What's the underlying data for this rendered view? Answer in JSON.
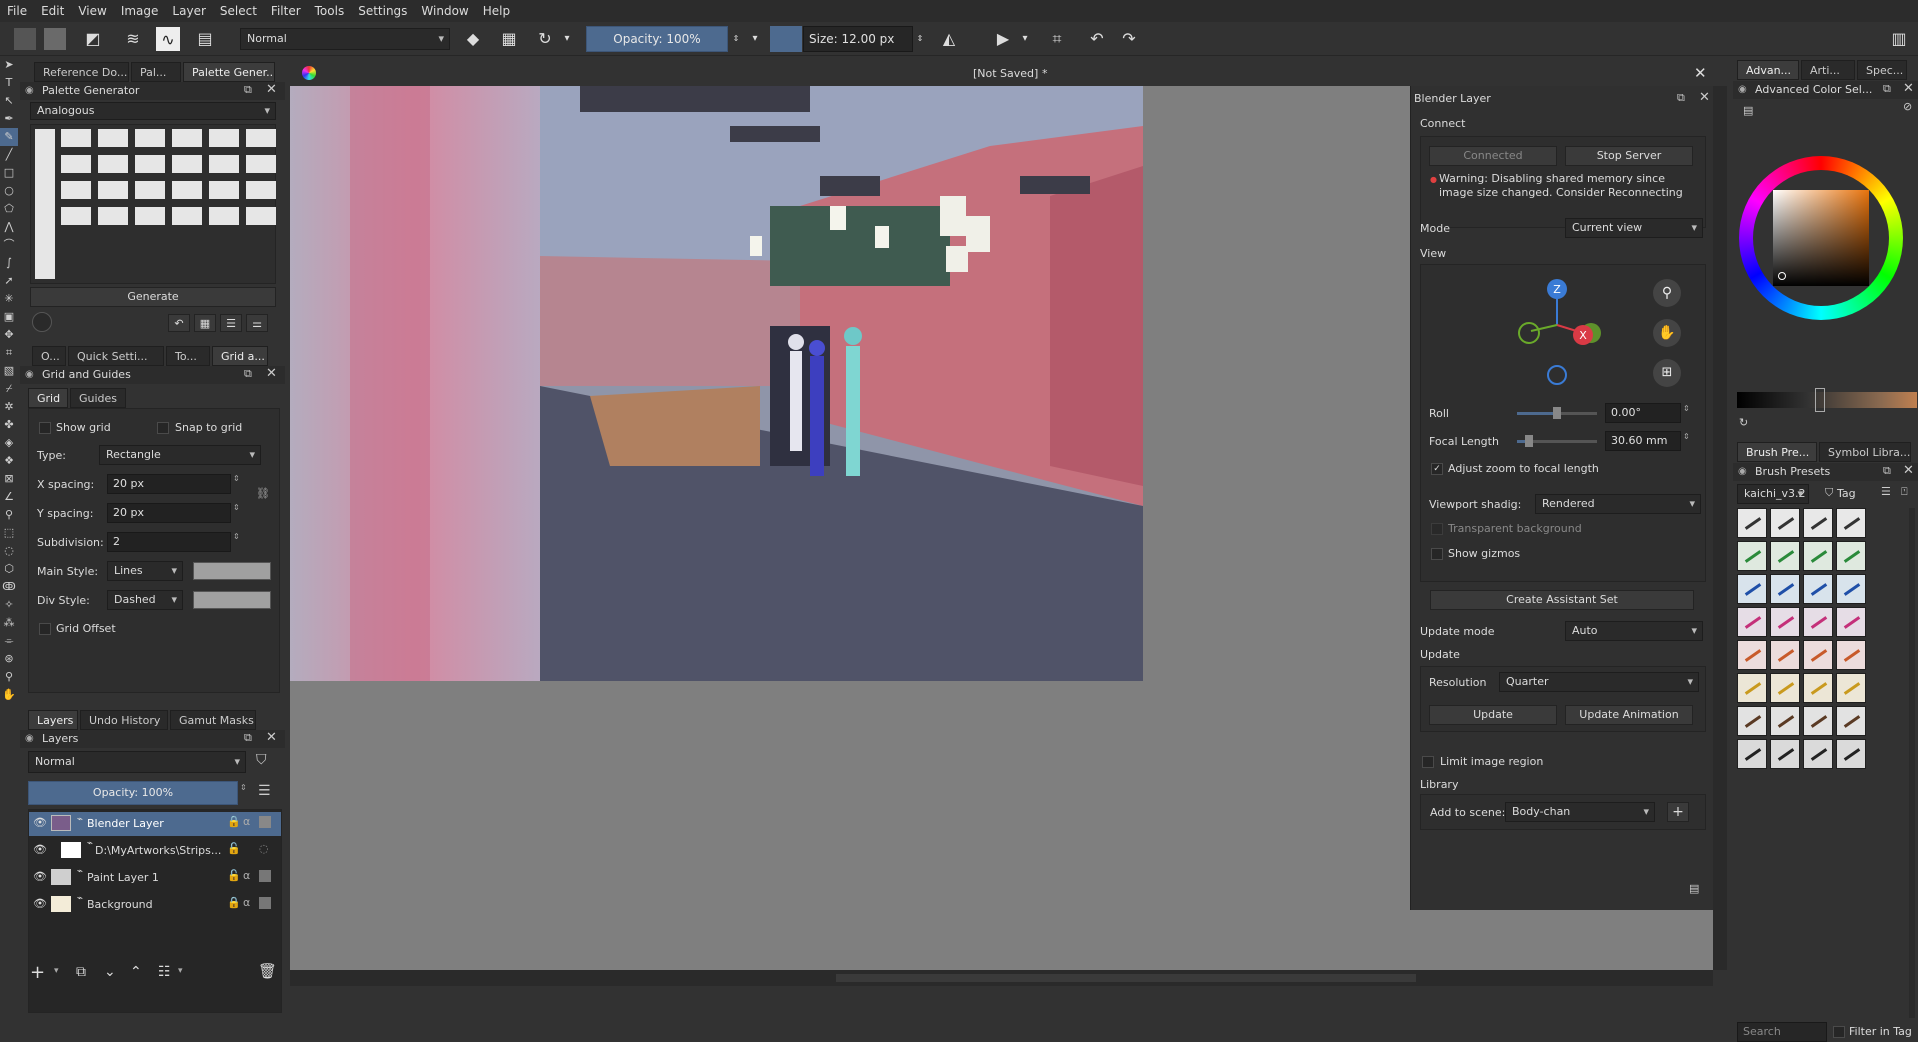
{
  "menu": [
    "File",
    "Edit",
    "View",
    "Image",
    "Layer",
    "Select",
    "Filter",
    "Tools",
    "Settings",
    "Window",
    "Help"
  ],
  "toolbar": {
    "blend_mode": "Normal",
    "opacity": "Opacity: 100%",
    "size": "Size: 12.00 px"
  },
  "document": {
    "title": "[Not Saved]",
    "modified_marker": "*"
  },
  "left_top_tabs": [
    "Reference Do...",
    "Pal...",
    "Palette Gener..."
  ],
  "palette_generator": {
    "title": "Palette Generator",
    "scheme": "Analogous",
    "generate_label": "Generate"
  },
  "mid_tabs": [
    "O...",
    "Quick Setti...",
    "To...",
    "Grid a..."
  ],
  "grid": {
    "title": "Grid and Guides",
    "tabs": [
      "Grid",
      "Guides"
    ],
    "show_grid": "Show grid",
    "snap_to_grid": "Snap to grid",
    "type_label": "Type:",
    "type_value": "Rectangle",
    "x_spacing_label": "X spacing:",
    "x_spacing": "20 px",
    "y_spacing_label": "Y spacing:",
    "y_spacing": "20 px",
    "subdivision_label": "Subdivision:",
    "subdivision": "2",
    "main_style_label": "Main Style:",
    "main_style": "Lines",
    "div_style_label": "Div Style:",
    "div_style": "Dashed",
    "grid_offset": "Grid Offset"
  },
  "bottom_tabs": [
    "Layers",
    "Undo History",
    "Gamut Masks"
  ],
  "layers": {
    "title": "Layers",
    "blend": "Normal",
    "opacity": "Opacity:  100%",
    "items": [
      {
        "name": "Blender Layer",
        "selected": true
      },
      {
        "name": "D:\\MyArtworks\\Strips...",
        "selected": false
      },
      {
        "name": "Paint Layer 1",
        "selected": false
      },
      {
        "name": "Background",
        "selected": false
      }
    ]
  },
  "blender": {
    "title": "Blender Layer",
    "connect_label": "Connect",
    "connected": "Connected",
    "stop_server": "Stop Server",
    "warning": "Warning: Disabling shared memory since image size changed. Consider Reconnecting",
    "mode_label": "Mode",
    "mode_value": "Current view",
    "view_label": "View",
    "roll_label": "Roll",
    "roll_value": "0.00°",
    "focal_label": "Focal Length",
    "focal_value": "30.60 mm",
    "adjust_zoom": "Adjust zoom to focal length",
    "viewport_label": "Viewport shadig:",
    "viewport_value": "Rendered",
    "transparent_bg": "Transparent background",
    "show_gizmos": "Show gizmos",
    "create_assistant": "Create Assistant Set",
    "update_mode_label": "Update mode",
    "update_mode_value": "Auto",
    "update_label": "Update",
    "resolution_label": "Resolution",
    "resolution_value": "Quarter",
    "update_btn": "Update",
    "update_anim_btn": "Update Animation",
    "limit_region": "Limit image region",
    "library_label": "Library",
    "add_scene_label": "Add to scene:",
    "add_scene_value": "Body-chan",
    "gizmo_axes": {
      "z": "Z",
      "x": "X"
    }
  },
  "right_top_tabs": [
    "Advan...",
    "Arti...",
    "Spec..."
  ],
  "color_selector": {
    "title": "Advanced Color Sel..."
  },
  "right_mid_tabs": [
    "Brush Pre...",
    "Symbol Libra..."
  ],
  "brush_presets": {
    "title": "Brush Presets",
    "tag_set": "kaichi_v3.2",
    "tag_label": "Tag",
    "search_placeholder": "Search",
    "filter_label": "Filter in Tag"
  },
  "colors": {
    "accent": "#4d6a8f",
    "panel": "#323232",
    "canvas_bg": "#7f7f7f"
  }
}
